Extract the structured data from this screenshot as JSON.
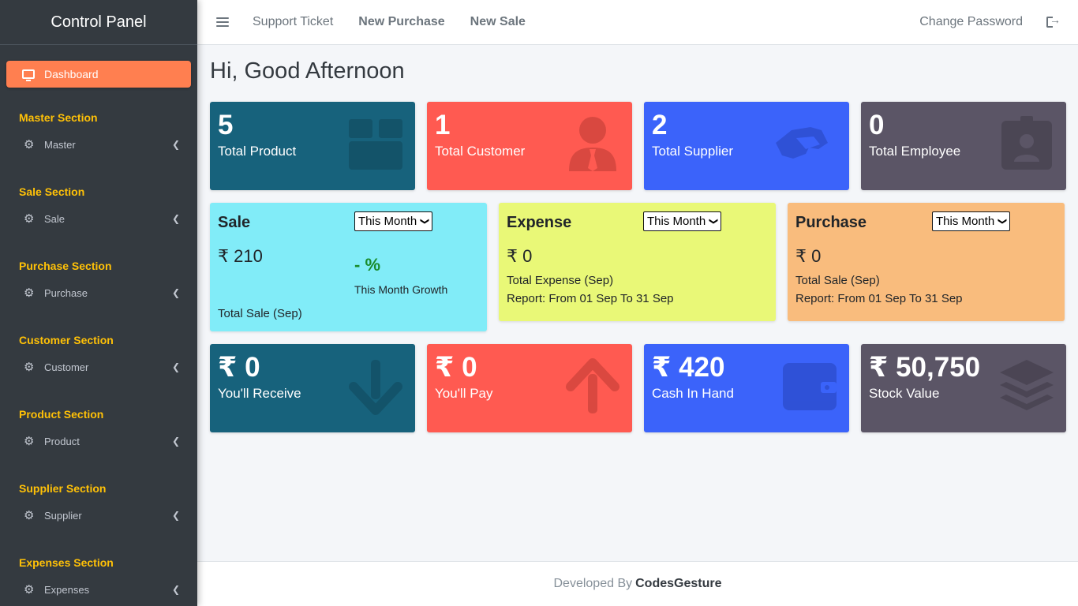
{
  "sidebar": {
    "brand": "Control Panel",
    "active": "Dashboard",
    "sections": [
      {
        "title": "Master Section",
        "item": "Master"
      },
      {
        "title": "Sale Section",
        "item": "Sale"
      },
      {
        "title": "Purchase Section",
        "item": "Purchase"
      },
      {
        "title": "Customer Section",
        "item": "Customer"
      },
      {
        "title": "Product Section",
        "item": "Product"
      },
      {
        "title": "Supplier Section",
        "item": "Supplier"
      },
      {
        "title": "Expenses Section",
        "item": "Expenses"
      }
    ]
  },
  "topbar": {
    "support": "Support Ticket",
    "new_purchase": "New Purchase",
    "new_sale": "New Sale",
    "change_password": "Change Password"
  },
  "greeting": "Hi, Good Afternoon",
  "stats": [
    {
      "value": "5",
      "label": "Total Product",
      "icon": "box-icon",
      "color": "#17627c"
    },
    {
      "value": "1",
      "label": "Total Customer",
      "icon": "user-tie-icon",
      "color": "#ff5a51"
    },
    {
      "value": "2",
      "label": "Total Supplier",
      "icon": "handshake-icon",
      "color": "#3b63fa"
    },
    {
      "value": "0",
      "label": "Total Employee",
      "icon": "id-badge-icon",
      "color": "#5b5566"
    }
  ],
  "sale": {
    "title": "Sale",
    "period": "This Month",
    "amount": "₹ 210",
    "growth": "- %",
    "growth_label": "This Month Growth",
    "total": "Total Sale (Sep)"
  },
  "expense": {
    "title": "Expense",
    "period": "This Month",
    "amount": "₹ 0",
    "total": "Total Expense (Sep)",
    "report": "Report: From 01 Sep To 31 Sep"
  },
  "purchase": {
    "title": "Purchase",
    "period": "This Month",
    "amount": "₹ 0",
    "total": "Total Sale (Sep)",
    "report": "Report: From 01 Sep To 31 Sep"
  },
  "money": [
    {
      "value": "₹ 0",
      "label": "You'll Receive",
      "icon": "arrow-down-icon"
    },
    {
      "value": "₹ 0",
      "label": "You'll Pay",
      "icon": "arrow-up-icon"
    },
    {
      "value": "₹ 420",
      "label": "Cash In Hand",
      "icon": "wallet-icon"
    },
    {
      "value": "₹ 50,750",
      "label": "Stock Value",
      "icon": "layers-icon"
    }
  ],
  "footer": {
    "prefix": "Developed By",
    "author": "CodesGesture"
  }
}
